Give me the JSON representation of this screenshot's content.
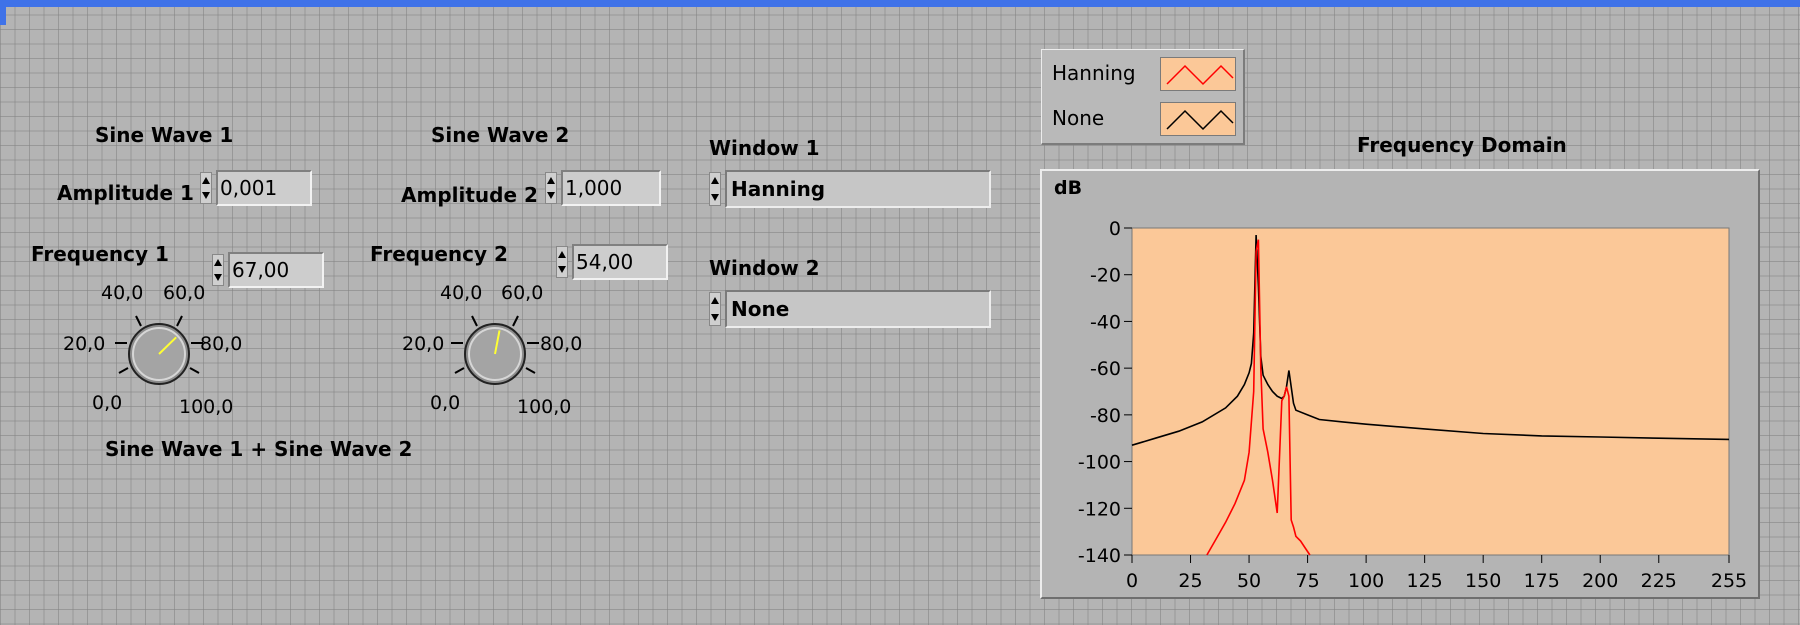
{
  "sine1": {
    "title": "Sine Wave 1",
    "amplitude_label": "Amplitude 1",
    "amplitude_value": "0,001",
    "frequency_label": "Frequency 1",
    "frequency_value": "67,00",
    "knob_value": 67,
    "knob_scale": [
      "0,0",
      "20,0",
      "40,0",
      "60,0",
      "80,0",
      "100,0"
    ]
  },
  "sine2": {
    "title": "Sine Wave 2",
    "amplitude_label": "Amplitude 2",
    "amplitude_value": "1,000",
    "frequency_label": "Frequency 2",
    "frequency_value": "54,00",
    "knob_value": 54,
    "knob_scale": [
      "0,0",
      "20,0",
      "40,0",
      "60,0",
      "80,0",
      "100,0"
    ]
  },
  "sum_label": "Sine Wave 1 + Sine Wave 2",
  "window1": {
    "label": "Window 1",
    "value": "Hanning"
  },
  "window2": {
    "label": "Window 2",
    "value": "None"
  },
  "colors": {
    "panel_bg": "#b4b4b4",
    "plot_bg": "#fbc898",
    "hanning_line": "#ff0000",
    "none_line": "#000000",
    "knob_needle": "#ffff33",
    "title_bar": "#3f72e8"
  },
  "chart_data": {
    "type": "line",
    "title": "Frequency Domain",
    "ylabel": "dB",
    "xlabel": "",
    "xlim": [
      0,
      255
    ],
    "ylim": [
      -140,
      0
    ],
    "x_ticks": [
      0,
      25,
      50,
      75,
      100,
      125,
      150,
      175,
      200,
      225,
      255
    ],
    "y_ticks": [
      0,
      -20,
      -40,
      -60,
      -80,
      -100,
      -120,
      -140
    ],
    "grid": false,
    "legend_placement": "above plot, top-left",
    "series": [
      {
        "name": "Hanning",
        "color": "#ff0000",
        "x": [
          32,
          36,
          40,
          44,
          48,
          50,
          52,
          53,
          54,
          55,
          56,
          58,
          60,
          62,
          64,
          65,
          66,
          67,
          68,
          69,
          70,
          72,
          74,
          76
        ],
        "y": [
          -140,
          -133,
          -126,
          -118,
          -108,
          -96,
          -70,
          -10,
          -5,
          -60,
          -86,
          -96,
          -108,
          -122,
          -74,
          -72,
          -68,
          -72,
          -125,
          -128,
          -132,
          -134,
          -137,
          -140
        ]
      },
      {
        "name": "None",
        "color": "#000000",
        "x": [
          0,
          10,
          20,
          30,
          40,
          45,
          48,
          50,
          51,
          52,
          53,
          54,
          55,
          56,
          58,
          60,
          62,
          64,
          65,
          66,
          67,
          68,
          69,
          70,
          75,
          80,
          90,
          100,
          125,
          150,
          175,
          200,
          225,
          255
        ],
        "y": [
          -93,
          -90,
          -87,
          -83,
          -77,
          -72,
          -67,
          -62,
          -58,
          -45,
          -3,
          -25,
          -55,
          -63,
          -67,
          -70,
          -72,
          -73,
          -72,
          -68,
          -61,
          -68,
          -75,
          -78,
          -80,
          -82,
          -83,
          -84,
          -86,
          -88,
          -89,
          -89.5,
          -90,
          -90.5
        ]
      }
    ]
  }
}
